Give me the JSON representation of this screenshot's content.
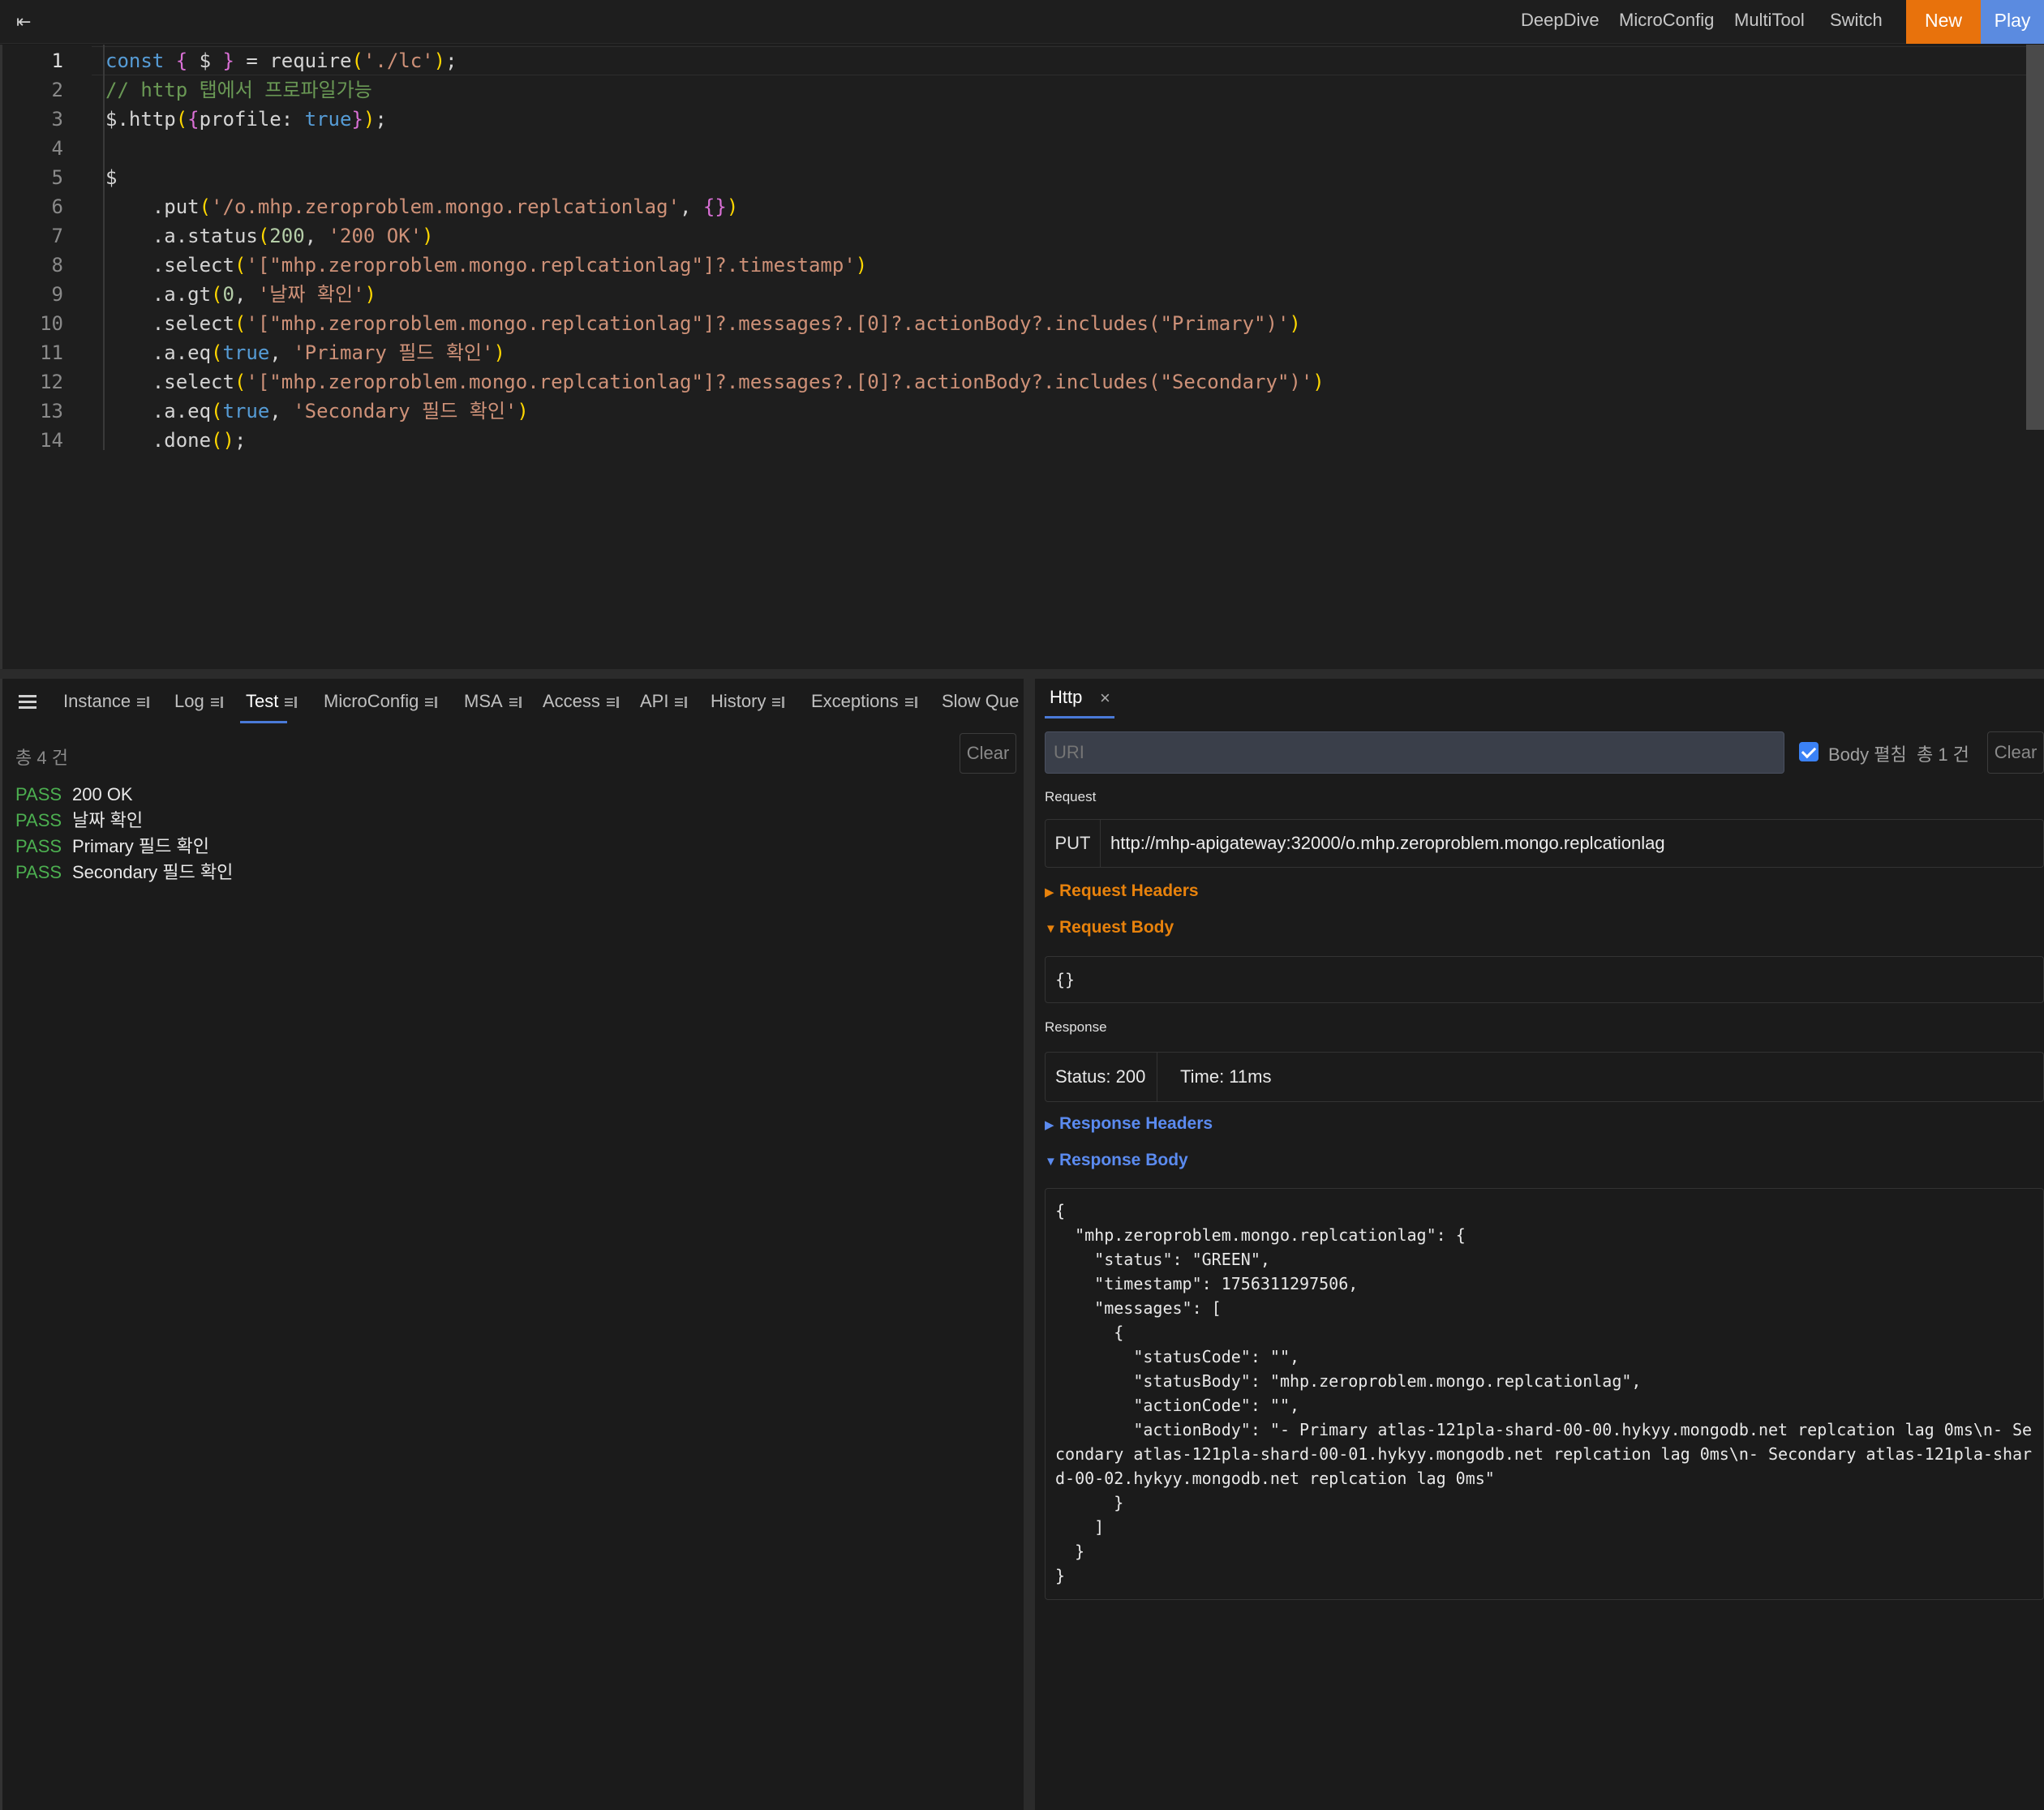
{
  "topbar": {
    "collapse_glyph": "⇤",
    "nav": [
      "DeepDive",
      "MicroConfig",
      "MultiTool",
      "Switch"
    ],
    "new_label": "New",
    "play_label": "Play",
    "new_color": "#e8720c",
    "play_color": "#5b8be0"
  },
  "editor": {
    "line_numbers": [
      "1",
      "2",
      "3",
      "4",
      "5",
      "6",
      "7",
      "8",
      "9",
      "10",
      "11",
      "12",
      "13",
      "14"
    ],
    "lines": [
      "const { $ } = require('./lc');",
      "// http 탭에서 프로파일가능",
      "$.http({profile: true});",
      "",
      "$",
      "    .put('/o.mhp.zeroproblem.mongo.replcationlag', {})",
      "    .a.status(200, '200 OK')",
      "    .select('[\"mhp.zeroproblem.mongo.replcationlag\"]?.timestamp')",
      "    .a.gt(0, '날짜 확인')",
      "    .select('[\"mhp.zeroproblem.mongo.replcationlag\"]?.messages?.[0]?.actionBody?.includes(\"Primary\")')",
      "    .a.eq(true, 'Primary 필드 확인')",
      "    .select('[\"mhp.zeroproblem.mongo.replcationlag\"]?.messages?.[0]?.actionBody?.includes(\"Secondary\")')",
      "    .a.eq(true, 'Secondary 필드 확인')",
      "    .done();"
    ]
  },
  "left_panel": {
    "tabs": [
      "Instance",
      "Log",
      "Test",
      "MicroConfig",
      "MSA",
      "Access",
      "API",
      "History",
      "Exceptions",
      "Slow Que"
    ],
    "active_tab": "Test",
    "count_label": "총 4 건",
    "clear_label": "Clear",
    "results": [
      {
        "status": "PASS",
        "name": "200 OK"
      },
      {
        "status": "PASS",
        "name": "날짜 확인"
      },
      {
        "status": "PASS",
        "name": "Primary 필드 확인"
      },
      {
        "status": "PASS",
        "name": "Secondary 필드 확인"
      }
    ],
    "pass_color": "#4caf50"
  },
  "right_panel": {
    "tab_label": "Http",
    "close_glyph": "×",
    "uri_placeholder": "URI",
    "body_toggle_label": "Body 펼침",
    "body_toggle_checked": true,
    "total_label": "총 1 건",
    "clear_label": "Clear",
    "request_label": "Request",
    "method": "PUT",
    "url": "http://mhp-apigateway:32000/o.mhp.zeroproblem.mongo.replcationlag",
    "request_headers_label": "Request Headers",
    "request_body_label": "Request Body",
    "request_body": "{}",
    "response_label": "Response",
    "status": "Status: 200",
    "time": "Time: 11ms",
    "response_headers_label": "Response Headers",
    "response_body_label": "Response Body",
    "response_body": "{\n  \"mhp.zeroproblem.mongo.replcationlag\": {\n    \"status\": \"GREEN\",\n    \"timestamp\": 1756311297506,\n    \"messages\": [\n      {\n        \"statusCode\": \"\",\n        \"statusBody\": \"mhp.zeroproblem.mongo.replcationlag\",\n        \"actionCode\": \"\",\n        \"actionBody\": \"- Primary atlas-121pla-shard-00-00.hykyy.mongodb.net replcation lag 0ms\\n- Secondary atlas-121pla-shard-00-01.hykyy.mongodb.net replcation lag 0ms\\n- Secondary atlas-121pla-shard-00-02.hykyy.mongodb.net replcation lag 0ms\"\n      }\n    ]\n  }\n}",
    "collapsed_glyph": "▶",
    "expanded_glyph": "▼",
    "request_color": "#e8820c",
    "response_color": "#5b8bf0"
  }
}
